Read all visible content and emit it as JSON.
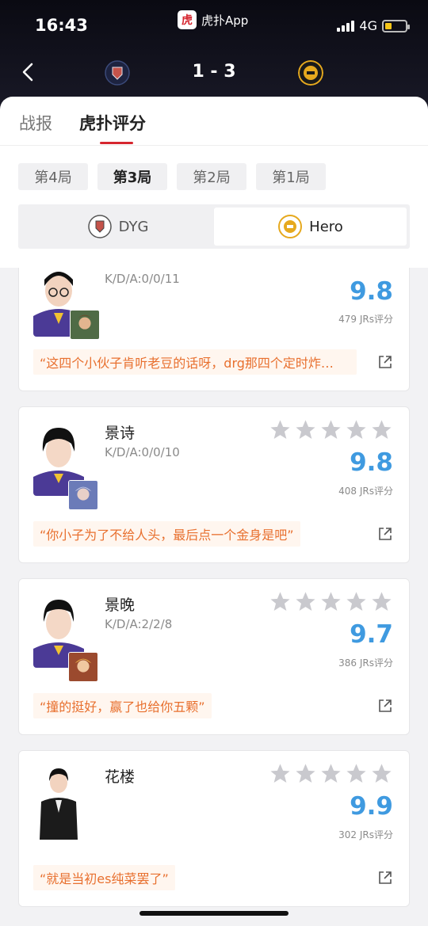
{
  "status": {
    "time": "16:43",
    "network": "4G",
    "app_label": "虎扑App",
    "app_icon_char": "虎"
  },
  "match": {
    "score": "1 - 3",
    "left_team": "DYG",
    "right_team": "Hero"
  },
  "tabs": [
    {
      "label": "战报"
    },
    {
      "label": "虎扑评分"
    }
  ],
  "rounds": [
    {
      "label": "第4局"
    },
    {
      "label": "第3局"
    },
    {
      "label": "第2局"
    },
    {
      "label": "第1局"
    }
  ],
  "team_switch": [
    {
      "label": "DYG"
    },
    {
      "label": "Hero"
    }
  ],
  "players": [
    {
      "name": "",
      "kda": "K/D/A:0/0/11",
      "score": "9.8",
      "votes": "479 JRs评分",
      "comment": "“这四个小伙子肯听老豆的话呀，drg那四个定时炸…"
    },
    {
      "name": "景诗",
      "kda": "K/D/A:0/0/10",
      "score": "9.8",
      "votes": "408 JRs评分",
      "comment": "“你小子为了不给人头，最后点一个金身是吧”"
    },
    {
      "name": "景晚",
      "kda": "K/D/A:2/2/8",
      "score": "9.7",
      "votes": "386 JRs评分",
      "comment": "“撞的挺好，赢了也给你五颗”"
    },
    {
      "name": "花楼",
      "kda": "",
      "score": "9.9",
      "votes": "302 JRs评分",
      "comment": "“就是当初es纯菜罢了”"
    }
  ],
  "colors": {
    "accent_red": "#d6262f",
    "score_blue": "#3f9ae0",
    "comment_orange": "#e8702f",
    "star_gray": "#c9c9ce"
  }
}
